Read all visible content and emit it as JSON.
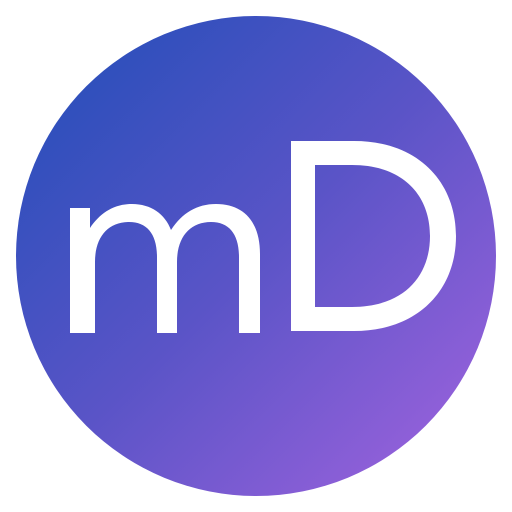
{
  "logo": {
    "text": "mD",
    "colors": {
      "gradient_start": "#1f4eb8",
      "gradient_mid": "#5a54c7",
      "gradient_end": "#a464df",
      "letter": "#ffffff",
      "background": "#ffffff"
    }
  }
}
